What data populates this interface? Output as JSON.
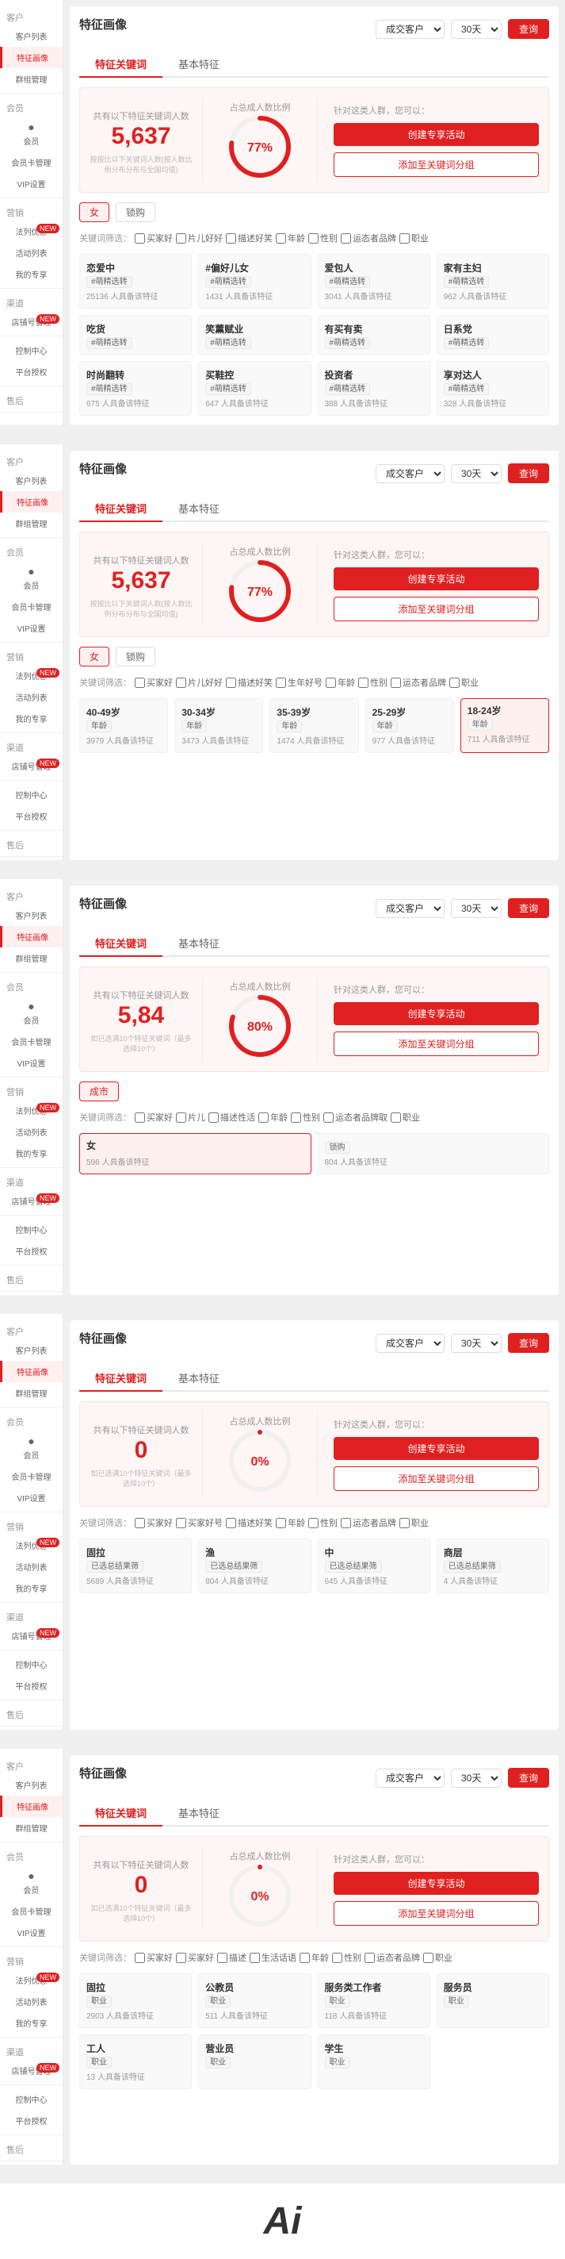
{
  "sections": [
    {
      "id": "section1",
      "sidebar": {
        "groups": [
          {
            "label": "客户",
            "items": [
              {
                "id": "customer-list",
                "label": "客户列表",
                "active": false
              },
              {
                "id": "feature-image",
                "label": "特征画像",
                "active": true
              },
              {
                "id": "group-mgmt",
                "label": "群组管理",
                "active": false
              }
            ]
          },
          {
            "label": "会员",
            "items": [
              {
                "id": "member",
                "label": "会员",
                "active": false,
                "icon": "●"
              },
              {
                "id": "card-mgmt",
                "label": "会员卡管理",
                "active": false
              },
              {
                "id": "vip",
                "label": "VIP设置",
                "active": false
              }
            ]
          },
          {
            "label": "营销",
            "items": [
              {
                "id": "promo",
                "label": "法列优惠",
                "active": false,
                "badge": "NEW"
              },
              {
                "id": "activity",
                "label": "活动列表",
                "active": false
              },
              {
                "id": "my-special",
                "label": "我的专享",
                "active": false
              }
            ]
          },
          {
            "label": "渠道",
            "items": [
              {
                "id": "shop-mgmt",
                "label": "店铺号管理",
                "active": false,
                "badge": "NEW"
              }
            ]
          },
          {
            "label": "",
            "items": [
              {
                "id": "control-center",
                "label": "控制中心",
                "active": false
              },
              {
                "id": "auth",
                "label": "平台授权",
                "active": false
              }
            ]
          },
          {
            "label": "售后",
            "items": []
          }
        ]
      },
      "header": {
        "title": "特征画像",
        "filters": {
          "type": "成交客户",
          "period": "30天",
          "btn": "查询"
        }
      },
      "tabs": [
        {
          "label": "特征关键词",
          "active": true
        },
        {
          "label": "基本特征",
          "active": false
        }
      ],
      "stats": {
        "left_label": "共有以下特征关键词人数",
        "left_number": "5,637",
        "right_label": "占总成人数比例",
        "right_percent": "77%",
        "desc": "按按比以下关键词人数(按人数比例分布分布与全国均值)",
        "hint": "针对这类人群，您可以：",
        "btn1": "创建专享活动",
        "btn2": "添加至关键词分组"
      },
      "gender_filter": [
        "女",
        "锁购"
      ],
      "keyword_filters": [
        {
          "label": "关键词筛选：",
          "items": [
            "口买家好",
            "口片儿好好",
            "口描述好笑",
            "口年龄",
            "口性别",
            "口运态者品牌",
            "口职业"
          ]
        }
      ],
      "tag_grid": [
        {
          "title": "恋爱中",
          "badge": "#萌精选转",
          "count": "25136 人具备该特征"
        },
        {
          "title": "#偏好儿女",
          "badge": "#萌精选转",
          "count": "1431 人具备该特征"
        },
        {
          "title": "爱包人",
          "badge": "#萌精选转",
          "count": "3041 人具备该特征"
        },
        {
          "title": "家有主妇",
          "badge": "#萌精选转",
          "count": "962 人具备该特征"
        },
        {
          "title": "吃货",
          "badge": "#萌精选转",
          "count": ""
        },
        {
          "title": "笑薰赋业",
          "badge": "#萌精选转",
          "count": ""
        },
        {
          "title": "有买有卖",
          "badge": "#萌精选转",
          "count": ""
        },
        {
          "title": "日系党",
          "badge": "#萌精选转",
          "count": ""
        },
        {
          "title": "时尚翻转",
          "badge": "#萌精选转",
          "count": "675 人具备该特征"
        },
        {
          "title": "买鞋控",
          "badge": "#萌精选转",
          "count": "647 人具备该特征"
        },
        {
          "title": "投资者",
          "badge": "#萌精选转",
          "count": "388 人具备该特征"
        },
        {
          "title": "享对达人",
          "badge": "#萌精选转",
          "count": "328 人具备该特征"
        }
      ]
    },
    {
      "id": "section2",
      "header": {
        "title": "特征画像",
        "filters": {
          "type": "成交客户",
          "period": "30天",
          "btn": "查询"
        }
      },
      "tabs": [
        {
          "label": "特征关键词",
          "active": true
        },
        {
          "label": "基本特征",
          "active": false
        }
      ],
      "stats": {
        "left_label": "共有以下特征关键词人数",
        "left_number": "5,637",
        "right_label": "占总成人数比例",
        "right_percent": "77%",
        "desc": "按按比以下关键词人数(按人数比例分布分布与全国均值)",
        "hint": "针对这类人群，您可以：",
        "btn1": "创建专享活动",
        "btn2": "添加至关键词分组"
      },
      "gender_filter": [
        "女",
        "锁购"
      ],
      "keyword_filters": [
        {
          "label": "关键词筛选：",
          "items": [
            "口买家好",
            "口片儿好好",
            "口描述好笑",
            "口生年好号",
            "口年龄",
            "口性别",
            "口运态者品牌",
            "口职业"
          ]
        }
      ],
      "tag_grid": [
        {
          "title": "40-49岁",
          "badge": "年龄",
          "count": "3979 人具备该特征",
          "active": false
        },
        {
          "title": "30-34岁",
          "badge": "年龄",
          "count": "3473 人具备该特征",
          "active": false
        },
        {
          "title": "35-39岁",
          "badge": "年龄",
          "count": "1474 人具备该特征",
          "active": false
        },
        {
          "title": "25-29岁",
          "badge": "年龄",
          "count": "977 人具备该特征",
          "active": false
        },
        {
          "title": "18-24岁",
          "badge": "年龄",
          "count": "711 人具备该特征",
          "active": true
        }
      ]
    },
    {
      "id": "section3",
      "header": {
        "title": "特征画像",
        "filters": {
          "type": "成交客户",
          "period": "30天",
          "btn": "查询"
        }
      },
      "tabs": [
        {
          "label": "特征关键词",
          "active": true
        },
        {
          "label": "基本特征",
          "active": false
        }
      ],
      "stats": {
        "left_label": "共有以下特征关键词人数",
        "left_number": "5,84",
        "right_label": "占总成人数比例",
        "right_percent": "80%",
        "desc": "如已选满10个特征关键词（最多选择10个）",
        "hint": "针对这类人群，您可以：",
        "btn1": "创建专享活动",
        "btn2": "添加至关键词分组"
      },
      "gender_filter": [
        "成市"
      ],
      "keyword_filters": [
        {
          "label": "关键词筛选：",
          "items": [
            "口买家好",
            "口片儿",
            "口描述性活",
            "口年龄",
            "口性别",
            "口运态者品牌取",
            "口职业"
          ]
        }
      ],
      "tag_grid": [
        {
          "title": "女",
          "badge": "",
          "count": "596 人具备该特征",
          "active": true
        },
        {
          "title": "",
          "badge": "锁购",
          "count": "804 人具备该特征",
          "active": false
        }
      ]
    },
    {
      "id": "section4",
      "header": {
        "title": "特征画像",
        "filters": {
          "type": "成交客户",
          "period": "30天",
          "btn": "查询"
        }
      },
      "tabs": [
        {
          "label": "特征关键词",
          "active": true
        },
        {
          "label": "基本特征",
          "active": false
        }
      ],
      "stats": {
        "left_label": "共有以下特征关键词人数",
        "left_number": "0",
        "right_label": "占总成人数比例",
        "right_percent": "0%",
        "desc": "如已选满10个特征关键词（最多选择10个）",
        "hint": "针对这类人群，您可以：",
        "btn1": "创建专享活动",
        "btn2": "添加至关键词分组"
      },
      "gender_filter": [],
      "keyword_filters": [
        {
          "label": "关键词筛选：",
          "items": [
            "口买家好",
            "口买家好号",
            "口描述好笑",
            "口年龄",
            "口性别",
            "口运态者品牌",
            "口职业"
          ]
        }
      ],
      "tag_grid": [
        {
          "title": "固拉",
          "badge": "已选总结果筛",
          "count": "5689 人具备该特征"
        },
        {
          "title": "渔",
          "badge": "已选总结果筛",
          "count": "804 人具备该特征"
        },
        {
          "title": "中",
          "badge": "已选总结果筛",
          "count": "645 人具备该特征"
        },
        {
          "title": "商层",
          "badge": "已选总结果筛",
          "count": "4 人具备该特征"
        }
      ]
    },
    {
      "id": "section5",
      "header": {
        "title": "特征画像",
        "filters": {
          "type": "成交客户",
          "period": "30天",
          "btn": "查询"
        }
      },
      "tabs": [
        {
          "label": "特征关键词",
          "active": true
        },
        {
          "label": "基本特征",
          "active": false
        }
      ],
      "stats": {
        "left_label": "共有以下特征关键词人数",
        "left_number": "0",
        "right_label": "占总成人数比例",
        "right_percent": "0%",
        "desc": "如已选满10个特征关键词（最多选择10个）",
        "hint": "针对这类人群，您可以：",
        "btn1": "创建专享活动",
        "btn2": "添加至关键词分组"
      },
      "gender_filter": [],
      "keyword_filters": [
        {
          "label": "关键词筛选：",
          "items": [
            "口买家好",
            "口买家好",
            "口描述",
            "口生活话语",
            "口年龄",
            "口性别",
            "口运态者品牌",
            "口职业"
          ]
        }
      ],
      "tag_grid": [
        {
          "title": "固拉",
          "badge": "职业",
          "count": "2903 人具备该特征"
        },
        {
          "title": "公教员",
          "badge": "职业",
          "count": "511 人具备该特征"
        },
        {
          "title": "服务类工作者",
          "badge": "职业",
          "count": "118 人具备该特征"
        },
        {
          "title": "服务员",
          "badge": "职业",
          "count": ""
        },
        {
          "title": "工人",
          "badge": "职业",
          "count": "13 人具备该特征"
        },
        {
          "title": "营业员",
          "badge": "职业",
          "count": ""
        },
        {
          "title": "学生",
          "badge": "职业",
          "count": ""
        }
      ]
    }
  ],
  "sidebar_labels": {
    "customer": "客户",
    "customer_list": "客户列表",
    "feature_image": "特征画像",
    "group_mgmt": "群组管理",
    "member": "会员",
    "card_mgmt": "会员卡管理",
    "vip": "VIP设置",
    "marketing": "营销",
    "promo": "法列优惠",
    "activity": "活动列表",
    "my_special": "我的专享",
    "channel": "渠道",
    "shop_mgmt": "店铺号管理",
    "control_center": "控制中心",
    "auth": "平台授权",
    "after_sale": "售后"
  }
}
